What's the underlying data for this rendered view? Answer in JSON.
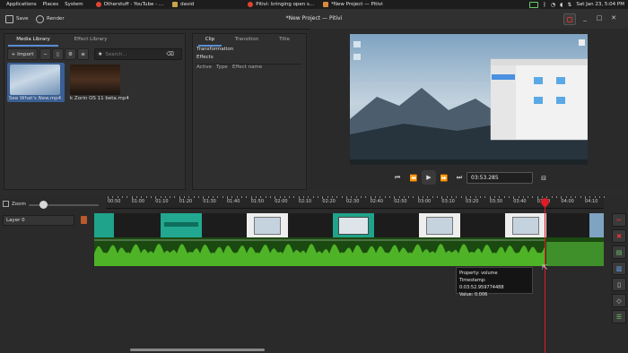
{
  "system_bar": {
    "menus": [
      "Applications",
      "Places",
      "System"
    ],
    "tasks": [
      {
        "label": "Otherstuff - YouTube - ...",
        "color": "#e0442f"
      },
      {
        "label": "david",
        "color": "#c8a34a"
      },
      {
        "label": "Pitivi: bringing open s...",
        "color": "#e0442f"
      },
      {
        "label": "*New Project — Pitivi",
        "color": "#d98a3a"
      }
    ],
    "clock": "Sat Jan 23, 5:04 PM",
    "indicator_icons": [
      "battery-icon",
      "bluetooth-icon",
      "wifi-icon",
      "volume-icon",
      "network-icon"
    ]
  },
  "header": {
    "save_label": "Save",
    "render_label": "Render",
    "title": "*New Project — Pitivi"
  },
  "media_panel": {
    "tabs": [
      "Media Library",
      "Effect Library"
    ],
    "active_tab": 0,
    "import_label": "Import",
    "search_placeholder": "Search...",
    "items": [
      {
        "label": "See What's New.mp4",
        "selected": true
      },
      {
        "label": "k Zorin OS 11 beta.mp4",
        "selected": false
      }
    ]
  },
  "clip_panel": {
    "tabs": [
      "Clip",
      "Transition",
      "Title"
    ],
    "active_tab": 0,
    "sections": [
      "Transformation",
      "Effects"
    ],
    "columns": [
      "Active",
      "Type",
      "Effect name"
    ]
  },
  "viewer": {
    "timecode": "03:53.285"
  },
  "timeline": {
    "zoom_label": "Zoom",
    "layer_label": "Layer 0",
    "ticks": [
      "00:50",
      "01:00",
      "01:10",
      "01:20",
      "01:30",
      "01:40",
      "01:50",
      "02:00",
      "02:10",
      "02:20",
      "02:30",
      "02:40",
      "02:50",
      "03:00",
      "03:10",
      "03:20",
      "03:30",
      "03:40",
      "03:50",
      "04:00",
      "04:10"
    ],
    "tooltip": {
      "line1": "Property: volume",
      "line2": "Timestamp: 0:03:52.959774488",
      "line3": "Value: 0.006"
    }
  },
  "colors": {
    "accent": "#5a8dd6",
    "playhead": "#e01b24",
    "audio_wave": "#4fb327",
    "clip_teal": "#1fa38a"
  }
}
